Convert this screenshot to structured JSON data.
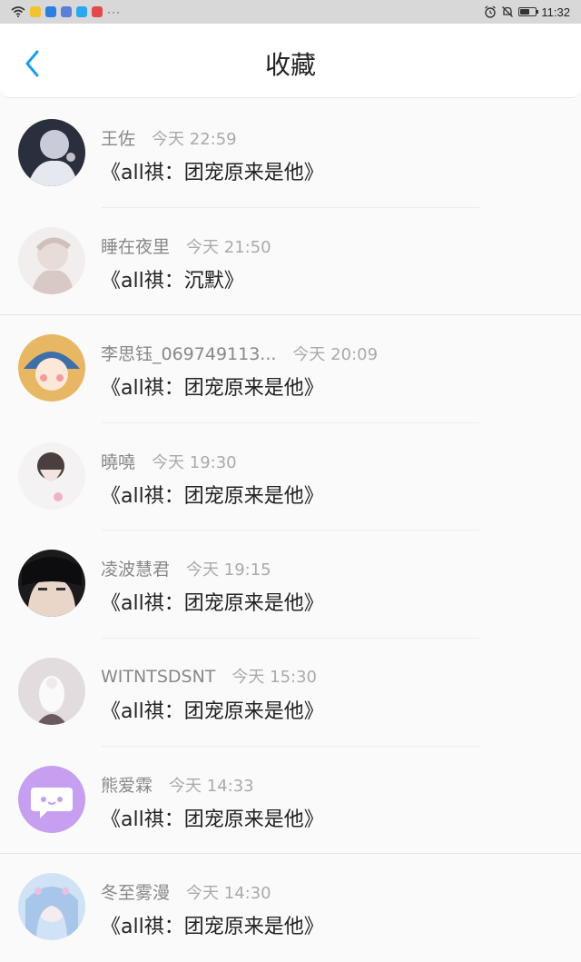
{
  "status_bar": {
    "time": "11:32",
    "more": "···"
  },
  "header": {
    "title": "收藏"
  },
  "items": [
    {
      "user": "王佐",
      "time": "今天 22:59",
      "content": "《all祺：团宠原来是他》"
    },
    {
      "user": "睡在夜里",
      "time": "今天 21:50",
      "content": "《all祺：沉默》"
    },
    {
      "user": "李思钰_069749113...",
      "time": "今天 20:09",
      "content": "《all祺：团宠原来是他》"
    },
    {
      "user": "曉嘵",
      "time": "今天 19:30",
      "content": "《all祺：团宠原来是他》"
    },
    {
      "user": "凌波慧君",
      "time": "今天 19:15",
      "content": "《all祺：团宠原来是他》"
    },
    {
      "user": "WITNTSDSNT",
      "time": "今天 15:30",
      "content": "《all祺：团宠原来是他》"
    },
    {
      "user": "熊爱霖",
      "time": "今天 14:33",
      "content": "《all祺：团宠原来是他》"
    },
    {
      "user": "冬至雾漫",
      "time": "今天 14:30",
      "content": "《all祺：团宠原来是他》"
    }
  ],
  "colors": {
    "accent": "#1e9bf0",
    "status_bar_bg": "#d8d8d8",
    "page_bg": "#fafafa"
  }
}
